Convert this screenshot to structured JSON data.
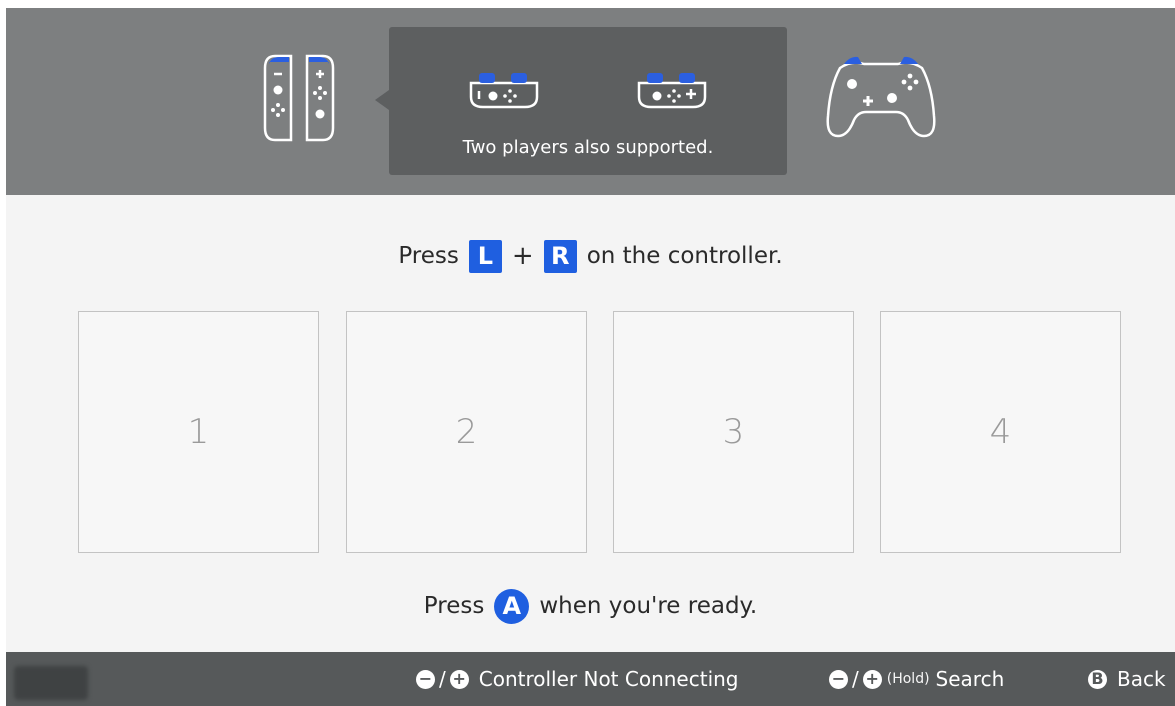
{
  "header": {
    "callout_text": "Two players also supported.",
    "icons": [
      "joycon-pair-icon",
      "joycon-left-sideways-icon",
      "joycon-right-sideways-icon",
      "pro-controller-icon"
    ]
  },
  "instruction": {
    "prefix": "Press",
    "button_l": "L",
    "plus": "+",
    "button_r": "R",
    "suffix": "on the controller."
  },
  "players": [
    {
      "number": "1"
    },
    {
      "number": "2"
    },
    {
      "number": "3"
    },
    {
      "number": "4"
    }
  ],
  "ready": {
    "prefix": "Press",
    "button": "A",
    "suffix": "when you're ready."
  },
  "footer": {
    "minus_glyph": "−",
    "plus_glyph": "+",
    "slash": "/",
    "not_connecting_label": "Controller Not Connecting",
    "hold_label": "(Hold)",
    "search_label": "Search",
    "back_button": "B",
    "back_label": "Back"
  },
  "colors": {
    "accent_blue": "#1f5fe0",
    "header_gray": "#7d7f80",
    "callout_gray": "#5d5f60",
    "footer_gray": "#56595a"
  }
}
